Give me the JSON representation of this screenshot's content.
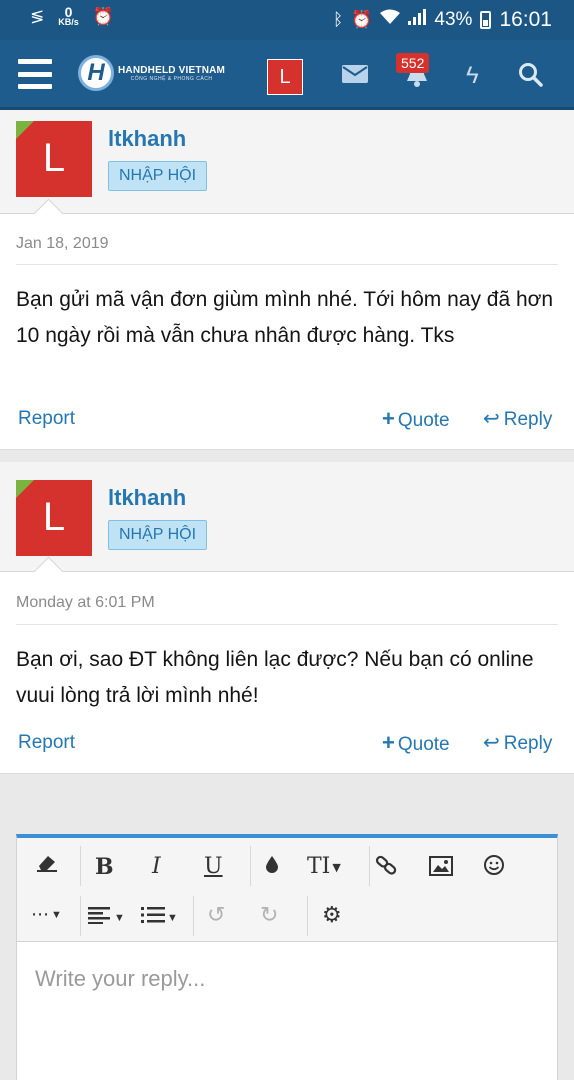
{
  "status_bar": {
    "speed_value": "0",
    "speed_unit": "KB/s",
    "battery": "43%",
    "time": "16:01"
  },
  "nav": {
    "logo_title": "HANDHELD VIETNAM",
    "logo_subtitle": "CÔNG NGHỆ & PHONG CÁCH",
    "logo_letter": "H",
    "avatar_letter": "L",
    "alerts_count": "552"
  },
  "posts": [
    {
      "username": "ltkhanh",
      "avatar_letter": "L",
      "role": "NHẬP HỘI",
      "date": "Jan 18, 2019",
      "message": "Bạn gửi mã vận đơn giùm mình nhé. Tới hôm nay đã hơn 10 ngày rồi mà vẫn chưa nhân được hàng. Tks",
      "report": "Report",
      "quote": "Quote",
      "reply": "Reply"
    },
    {
      "username": "ltkhanh",
      "avatar_letter": "L",
      "role": "NHẬP HỘI",
      "date": "Monday at 6:01 PM",
      "message": "Bạn ơi, sao ĐT không liên lạc được? Nếu bạn có online vuui lòng trả lời mình nhé!",
      "report": "Report",
      "quote": "Quote",
      "reply": "Reply"
    }
  ],
  "editor": {
    "placeholder": "Write your reply...",
    "bold": "B",
    "italic": "I",
    "underline": "U",
    "text_size": "TI"
  },
  "colors": {
    "header_bg": "#1f5c8e",
    "link": "#2577b1",
    "avatar_bg": "#d6322d",
    "badge_bg": "#d6322d",
    "editor_accent": "#3a8fd5"
  }
}
